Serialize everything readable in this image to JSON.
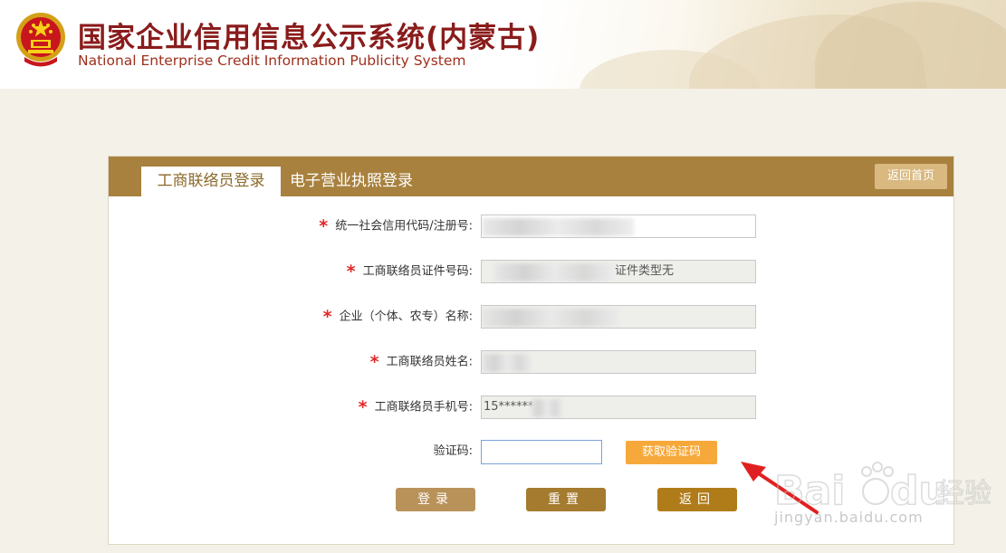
{
  "header": {
    "title_cn": "国家企业信用信息公示系统(内蒙古)",
    "title_en": "National Enterprise Credit Information Publicity System"
  },
  "tabs": {
    "active": "工商联络员登录",
    "other": "电子营业执照登录"
  },
  "back_home_label": "返回首页",
  "form": {
    "credit_code_label": "统一社会信用代码/注册号:",
    "id_number_label": "工商联络员证件号码:",
    "id_type_text": "证件类型无",
    "enterprise_name_label": "企业（个体、农专）名称:",
    "contact_name_label": "工商联络员姓名:",
    "phone_label": "工商联络员手机号:",
    "phone_value": "15******",
    "captcha_label": "验证码:",
    "get_code_label": "获取验证码",
    "required_mark": "*"
  },
  "buttons": {
    "login": "登录",
    "reset": "重置",
    "back": "返回"
  },
  "watermark": {
    "url": "jingyan.baidu.com"
  },
  "colors": {
    "panel_bar": "#a8813e",
    "title_red": "#8a1c1c",
    "get_code_orange": "#f6a93a",
    "required_red": "#e02828"
  }
}
